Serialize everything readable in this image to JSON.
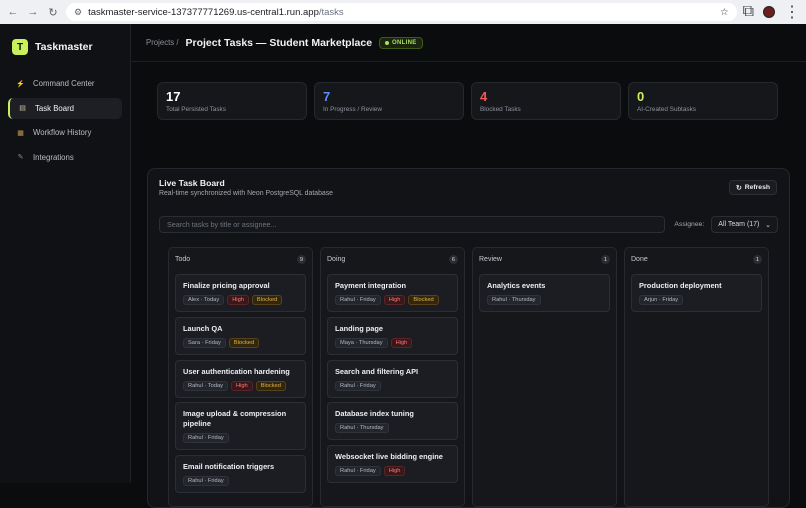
{
  "browser": {
    "url_host": "taskmaster-service-137377771269.us-central1.run.app",
    "url_path": "/tasks"
  },
  "app": {
    "logo_letter": "T",
    "name": "Taskmaster"
  },
  "sidebar": {
    "items": [
      {
        "label": "Command Center",
        "icon": "lightning-icon",
        "active": false
      },
      {
        "label": "Task Board",
        "icon": "clipboard-icon",
        "active": true
      },
      {
        "label": "Workflow History",
        "icon": "archive-icon",
        "active": false
      },
      {
        "label": "Integrations",
        "icon": "wrench-icon",
        "active": false
      }
    ]
  },
  "header": {
    "breadcrumb": "Projects /",
    "title": "Project Tasks — Student Marketplace",
    "status": "ONLINE"
  },
  "stats": [
    {
      "value": "17",
      "label": "Total Persisted Tasks",
      "color": "#ffffff"
    },
    {
      "value": "7",
      "label": "In Progress / Review",
      "color": "#5b8ef7"
    },
    {
      "value": "4",
      "label": "Blocked Tasks",
      "color": "#f05a5a"
    },
    {
      "value": "0",
      "label": "AI-Created Subtasks",
      "color": "#c8f05a"
    }
  ],
  "board": {
    "title": "Live Task Board",
    "subtitle": "Real-time synchronized with Neon PostgreSQL database",
    "refresh_label": "Refresh",
    "search_placeholder": "Search tasks by title or assignee...",
    "assignee_label": "Assignee:",
    "assignee_value": "All Team (17)"
  },
  "columns": [
    {
      "name": "Todo",
      "count": "9",
      "cards": [
        {
          "title": "Finalize pricing approval",
          "owner": "Alex · Today",
          "tags": [
            "High",
            "Blocked"
          ]
        },
        {
          "title": "Launch QA",
          "owner": "Sara · Friday",
          "tags": [
            "Blocked"
          ]
        },
        {
          "title": "User authentication hardening",
          "owner": "Rahul · Today",
          "tags": [
            "High",
            "Blocked"
          ]
        },
        {
          "title": "Image upload & compression pipeline",
          "owner": "Rahul · Friday",
          "tags": []
        },
        {
          "title": "Email notification triggers",
          "owner": "Rahul · Friday",
          "tags": []
        }
      ]
    },
    {
      "name": "Doing",
      "count": "6",
      "cards": [
        {
          "title": "Payment integration",
          "owner": "Rahul · Friday",
          "tags": [
            "High",
            "Blocked"
          ]
        },
        {
          "title": "Landing page",
          "owner": "Maya · Thursday",
          "tags": [
            "High"
          ]
        },
        {
          "title": "Search and filtering API",
          "owner": "Rahul · Friday",
          "tags": []
        },
        {
          "title": "Database index tuning",
          "owner": "Rahul · Thursday",
          "tags": []
        },
        {
          "title": "Websocket live bidding engine",
          "owner": "Rahul · Friday",
          "tags": [
            "High"
          ]
        }
      ]
    },
    {
      "name": "Review",
      "count": "1",
      "cards": [
        {
          "title": "Analytics events",
          "owner": "Rahul · Thursday",
          "tags": []
        }
      ]
    },
    {
      "name": "Done",
      "count": "1",
      "cards": [
        {
          "title": "Production deployment",
          "owner": "Arjun · Friday",
          "tags": []
        }
      ]
    }
  ]
}
